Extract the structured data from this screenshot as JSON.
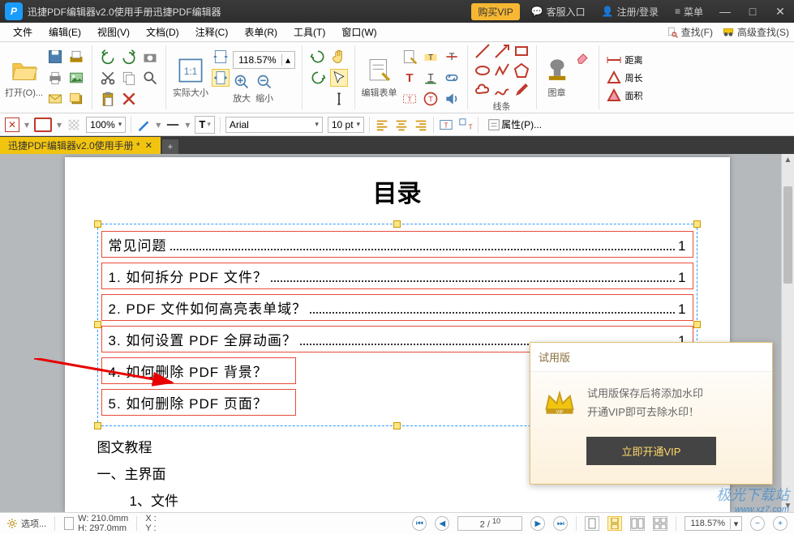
{
  "title": "迅捷PDF编辑器v2.0使用手册迅捷PDF编辑器",
  "titlebar": {
    "vip": "购买VIP",
    "support": "客服入口",
    "login": "注册/登录",
    "menu": "菜单"
  },
  "menu": {
    "file": "文件",
    "edit": "编辑(E)",
    "view": "视图(V)",
    "doc": "文档(D)",
    "annot": "注释(C)",
    "form": "表单(R)",
    "tool": "工具(T)",
    "window": "窗口(W)",
    "find": "查找(F)",
    "advfind": "高级查找(S)"
  },
  "ribbon": {
    "open": "打开(O)...",
    "realsize": "实际大小",
    "zoom": "118.57%",
    "zoomin": "放大",
    "zoomout": "缩小",
    "editform": "编辑表单",
    "lines": "线条",
    "stamp": "图章",
    "distance": "距离",
    "perimeter": "周长",
    "area": "面积"
  },
  "toolbar2": {
    "opacity": "100%",
    "font": "Arial",
    "size": "10 pt",
    "props": "属性(P)..."
  },
  "doctab": {
    "name": "迅捷PDF编辑器v2.0使用手册 *"
  },
  "pageContent": {
    "title": "目录",
    "items": [
      {
        "text": "常见问题",
        "page": "1"
      },
      {
        "text": "1.  如何拆分 PDF 文件？",
        "page": "1"
      },
      {
        "text": "2.  PDF 文件如何高亮表单域？",
        "page": "1"
      },
      {
        "text": "3.  如何设置 PDF 全屏动画？",
        "page": "1"
      },
      {
        "text": "4.  如何删除 PDF 背景？",
        "page": ""
      },
      {
        "text": "5.  如何删除 PDF 页面？",
        "page": ""
      }
    ],
    "after": [
      "图文教程",
      "一、主界面",
      "1、文件"
    ]
  },
  "trial": {
    "header": "试用版",
    "line1": "试用版保存后将添加水印",
    "line2": "开通VIP即可去除水印！",
    "btn": "立即开通VIP"
  },
  "status": {
    "options": "选项...",
    "w": "W: 210.0mm",
    "h": "H: 297.0mm",
    "x": "X :",
    "y": "Y :",
    "page": "2",
    "total": "10",
    "zoom": "118.57%"
  },
  "watermark": {
    "main": "极光下载站",
    "sub": "www.xz7.com"
  }
}
